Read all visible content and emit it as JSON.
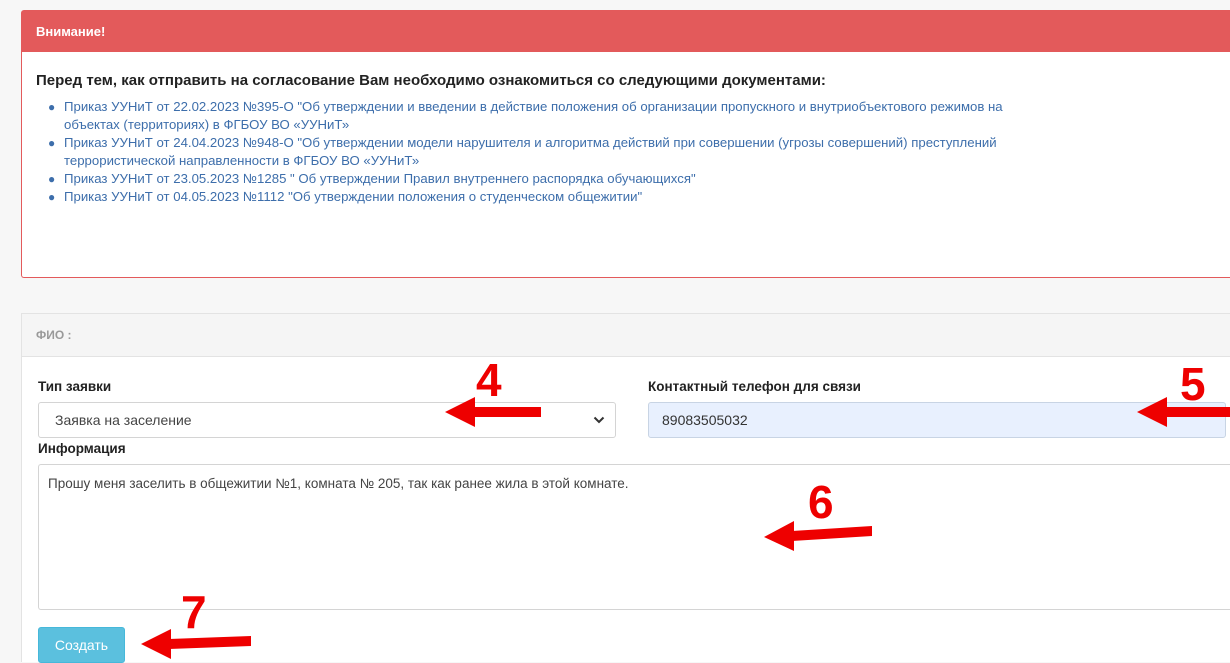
{
  "alert": {
    "title": "Внимание!",
    "intro": "Перед тем, как отправить на согласование Вам необходимо ознакомиться со следующими документами:",
    "documents": [
      {
        "line1": "Приказ УУНиТ от 22.02.2023 №395-О \"Об утверждении и введении в действие положения об организации пропускного и внутриобъектового режимов на",
        "line2": "объектах (территориях) в ФГБОУ ВО «УУНиТ»"
      },
      {
        "line1": "Приказ УУНиТ от 24.04.2023 №948-О \"Об утверждении модели нарушителя и алгоритма действий при совершении (угрозы совершений) преступлений",
        "line2": "террористической направленности в ФГБОУ ВО «УУНиТ»"
      },
      {
        "line1": "Приказ УУНиТ от 23.05.2023 №1285 \" Об утверждении Правил внутреннего распорядка обучающихся\"",
        "line2": ""
      },
      {
        "line1": "Приказ УУНиТ от 04.05.2023 №1112 \"Об утверждении положения о студенческом общежитии\"",
        "line2": ""
      }
    ]
  },
  "form": {
    "header": "ФИО :",
    "request_type_label": "Тип заявки",
    "request_type_value": "Заявка на заселение",
    "phone_label": "Контактный телефон для связи",
    "phone_value": "89083505032",
    "info_label": "Информация",
    "info_value": "Прошу меня заселить в  общежитии №1, комната № 205, так как ранее жила в этой комнате.",
    "create_button": "Создать"
  },
  "annotations": {
    "color": "#ee0000",
    "labels": [
      "4",
      "5",
      "6",
      "7"
    ]
  },
  "colors": {
    "alert_red": "#e35a5b",
    "link_blue": "#3d6eab",
    "button_info": "#5bc0de",
    "autofill_bg": "#e8f0fe"
  }
}
